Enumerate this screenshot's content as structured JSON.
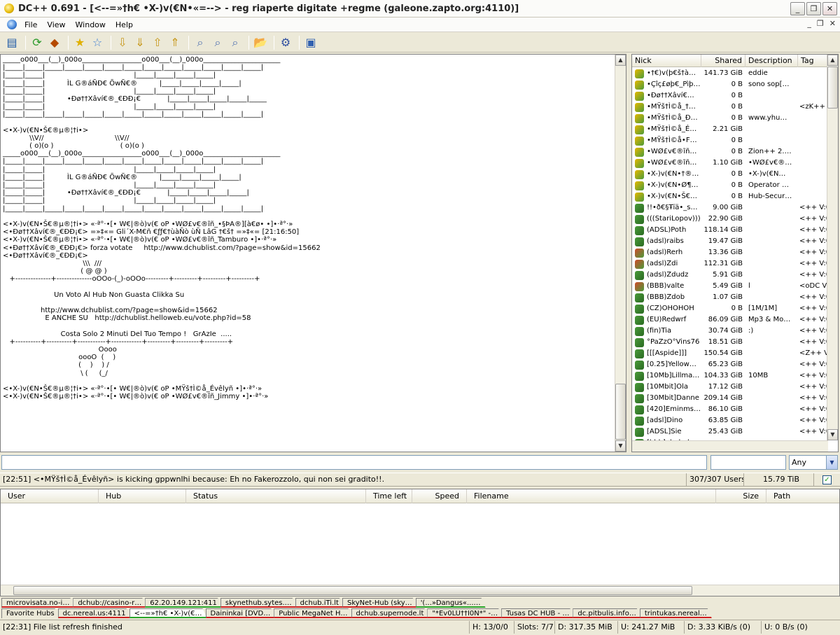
{
  "window": {
    "title": "DC++ 0.691 - [<--=»†h€ •X-)v(€N•«=--> -  reg riaperte digitate +regme (galeone.zapto.org:4110)]",
    "min_symbol": "_",
    "restore_symbol": "❐",
    "close_symbol": "✕"
  },
  "menu": {
    "items": [
      "File",
      "View",
      "Window",
      "Help"
    ],
    "mdi_min": "_",
    "mdi_restore": "❐",
    "mdi_close": "✕"
  },
  "toolbar": {
    "icons": [
      "public-hubs-icon",
      "reconnect-icon",
      "follow-redirect-icon",
      "favorite-hubs-icon",
      "favorite-users-icon",
      "download-queue-icon",
      "finished-downloads-icon",
      "upload-queue-icon",
      "finished-uploads-icon",
      "search-icon",
      "adl-search-icon",
      "search-spy-icon",
      "open-file-list-icon",
      "settings-icon",
      "notepad-icon"
    ],
    "glyphs": [
      "▤",
      "⟳",
      "◆",
      "★",
      "☆",
      "⇩",
      "⇓",
      "⇧",
      "⇑",
      "⌕",
      "⌕",
      "⌕",
      "📂",
      "⚙",
      "▣"
    ]
  },
  "chat": {
    "lines": [
      "_____o000___(__)_000o_________________o000___(__)_000o______________________",
      "|_____|_____|_____|_____|_____|_____|_____|_____|_____|_____|_____|_____|_____|",
      "|_____|_____|                                        |_____|_____|_____|_____|",
      "|_____|_____|          ÌL G®áÑÐ€ ÕwÑ€®          |_____|_____|_____|_____|",
      "|_____|_____|                                        |_____|_____|_____|_____|",
      "|_____|_____|          •Ðø††Xâví€®_€ÐÐ¡€            |_____|_____|_____|_____|_____",
      "|_____|_____|                                        |_____|_____|_____|_____|",
      "|_____|_____|_____|_____|_____|_____|_____|_____|_____|_____|_____|_____|_____|",
      "",
      "<•X-)v(€N•Š€®µ®¦†i•>",
      "            \\\\V//                                \\\\V//",
      "            ( o)(o )                              ( o)(o )",
      "_____o000___(__)_000o_________________o000___(__)_000o______________________",
      "|_____|_____|_____|_____|_____|_____|_____|_____|_____|_____|_____|_____|_____|",
      "|_____|_____|                                        |_____|_____|_____|_____|",
      "|_____|_____|          ÌL G®áÑÐ€ ÕwÑ€®          |_____|_____|_____|_____|",
      "|_____|_____|                                        |_____|_____|_____|_____|",
      "|_____|_____|          •Ðø††Xâví€®_€ÐÐ¡€            |_____|_____|_____|_____|",
      "|_____|_____|                                        |_____|_____|_____|_____|",
      "|_____|_____|_____|_____|_____|_____|_____|_____|_____|_____|_____|_____|_____|",
      "",
      "<•X-)v(€N•Š€®µ®¦†i•> «·ª°·•[• W€|®ò)v(€ oP •WØ£v€®ĩñ_•§ÞA®][à€ø• •]•·ª°·»",
      "<•Ðø††Xâví€®_€ÐÐ¡€> =»‡«= Gli´X-M€ñ €ƒƒ€†ùàÑò ùÑ LâG †€š† =»‡«= [21:16:50]",
      "<•X-)v(€N•Š€®µ®¦†i•> «·ª°·•[• W€|®ò)v(€ oP •WØ£v€®ĩñ_Tamburo •]•·ª°·»",
      "<•Ðø††Xâví€®_€ÐÐ¡€> forza votate     http://www.dchublist.com/?page=show&id=15662",
      "<•Ðø††Xâví€®_€ÐÐ¡€>",
      "                                    \\\\\\  ///",
      "                                   ( @ @ )",
      "   +--------------+--------------oOOo-(_)-oOOo---------+---------+---------+---------+",
      "",
      "                       Un Voto Al Hub Non Guasta Clikka Su",
      "",
      "                 http://www.dchublist.com/?page=show&id=15662",
      "                   E ANCHE SU   http://dchublist.helloweb.eu/vote.php?id=58",
      "",
      "                          Costa Solo 2 Minuti Del Tuo Tempo !   GrAzIe  .....",
      "   +----------+----------+-----------+------------+---------+---------+---------+",
      "                                           Oooo",
      "                                  oooO  (    )",
      "                                  (    )    ) /",
      "                                   \\ (     (_/",
      "",
      "<•X-)v(€N•Š€®µ®¦†i•> «·ª°·•[• W€|®ò)v(€ oP •MŸš†Ì©å_Évêlyñ •]•·ª°·»",
      "<•X-)v(€N•Š€®µ®¦†i•> «·ª°·•[• W€|®ò)v(€ oP •WØ£v€®ĩñ_Jimmy •]•·ª°·»"
    ]
  },
  "userlist": {
    "headers": [
      "Nick",
      "Shared",
      "Description",
      "Tag"
    ],
    "rows": [
      {
        "nick": "•†€)v(þ€š†à…",
        "shared": "141.73 GiB",
        "desc": "eddie",
        "tag": "",
        "kind": "op"
      },
      {
        "nick": "•Çîç£øþ€_Pìþ…",
        "shared": "0 B",
        "desc": "sono sop[…",
        "tag": "",
        "kind": "op"
      },
      {
        "nick": "•Ðø††Xâví€…",
        "shared": "0 B",
        "desc": "",
        "tag": "",
        "kind": "op"
      },
      {
        "nick": "•MŸš†Ì©å_†…",
        "shared": "0 B",
        "desc": "",
        "tag": "<zK++ V",
        "kind": "op"
      },
      {
        "nick": "•MŸš†Ì©å_Ð…",
        "shared": "0 B",
        "desc": "www.yhu…",
        "tag": "",
        "kind": "op"
      },
      {
        "nick": "•MŸš†Ì©å_É…",
        "shared": "2.21 GiB",
        "desc": "",
        "tag": "",
        "kind": "op"
      },
      {
        "nick": "•MŸš†Ì©å•F…",
        "shared": "0 B",
        "desc": "",
        "tag": "",
        "kind": "op"
      },
      {
        "nick": "•WØ£v€®ĩñ…",
        "shared": "0 B",
        "desc": "Zion++ 2.…",
        "tag": "",
        "kind": "op"
      },
      {
        "nick": "•WØ£v€®ĩñ…",
        "shared": "1.10 GiB",
        "desc": "•WØ£v€®…",
        "tag": "",
        "kind": "op"
      },
      {
        "nick": "•X-)v(€N•†®…",
        "shared": "0 B",
        "desc": "•X-)v(€N…",
        "tag": "",
        "kind": "op"
      },
      {
        "nick": "•X-)v(€N•Ø¶…",
        "shared": "0 B",
        "desc": "Operator …",
        "tag": "",
        "kind": "op"
      },
      {
        "nick": "•X-)v(€N•Š€…",
        "shared": "0 B",
        "desc": "Hub-Secur…",
        "tag": "",
        "kind": "op"
      },
      {
        "nick": "!!•ð€§Ŧïä•_s…",
        "shared": "9.00 GiB",
        "desc": "",
        "tag": "<++ V:0",
        "kind": "user"
      },
      {
        "nick": "(((StariLopov)))",
        "shared": "22.90 GiB",
        "desc": "",
        "tag": "<++ V:0",
        "kind": "user"
      },
      {
        "nick": "(ADSL)Poth",
        "shared": "118.14 GiB",
        "desc": "",
        "tag": "<++ V:0",
        "kind": "user"
      },
      {
        "nick": "(adsl)raibs",
        "shared": "19.47 GiB",
        "desc": "",
        "tag": "<++ V:0",
        "kind": "user"
      },
      {
        "nick": "(adsl)Rerh",
        "shared": "13.36 GiB",
        "desc": "",
        "tag": "<++ V:0",
        "kind": "red"
      },
      {
        "nick": "(adsl)Zdi",
        "shared": "112.31 GiB",
        "desc": "",
        "tag": "<++ V:0",
        "kind": "red"
      },
      {
        "nick": "(adsl)Zdudz",
        "shared": "5.91 GiB",
        "desc": "",
        "tag": "<++ V:0",
        "kind": "user"
      },
      {
        "nick": "(BBB)valte",
        "shared": "5.49 GiB",
        "desc": "l",
        "tag": "<oDC V:",
        "kind": "red"
      },
      {
        "nick": "(BBB)Zdob",
        "shared": "1.07 GiB",
        "desc": "",
        "tag": "<++ V:0",
        "kind": "user"
      },
      {
        "nick": "(CZ)OHOHOH",
        "shared": "0 B",
        "desc": "[1M/1M]",
        "tag": "<++ V:0",
        "kind": "user"
      },
      {
        "nick": "(EU)Redwrf",
        "shared": "86.09 GiB",
        "desc": "Mp3 & Mo…",
        "tag": "<++ V:0",
        "kind": "user"
      },
      {
        "nick": "(fin)Tia",
        "shared": "30.74 GiB",
        "desc": ":)",
        "tag": "<++ V:0",
        "kind": "user"
      },
      {
        "nick": "°PaZzO°Vins76",
        "shared": "18.51 GiB",
        "desc": "",
        "tag": "<++ V:0",
        "kind": "user"
      },
      {
        "nick": "[[[Aspide]]]",
        "shared": "150.54 GiB",
        "desc": "",
        "tag": "<Z++ V:",
        "kind": "user"
      },
      {
        "nick": "[0.25]Yellow…",
        "shared": "65.23 GiB",
        "desc": "",
        "tag": "<++ V:0",
        "kind": "user"
      },
      {
        "nick": "[10Mb]Lillma…",
        "shared": "104.33 GiB",
        "desc": "10MB",
        "tag": "<++ V:0",
        "kind": "user"
      },
      {
        "nick": "[10Mbit]Ola",
        "shared": "17.12 GiB",
        "desc": "",
        "tag": "<++ V:0",
        "kind": "user"
      },
      {
        "nick": "[30Mbit]Danne",
        "shared": "209.14 GiB",
        "desc": "",
        "tag": "<++ V:0",
        "kind": "user"
      },
      {
        "nick": "[420]Eminms…",
        "shared": "86.10 GiB",
        "desc": "",
        "tag": "<++ V:0",
        "kind": "user"
      },
      {
        "nick": "[adsl]Dino",
        "shared": "63.85 GiB",
        "desc": "",
        "tag": "<++ V:0",
        "kind": "user"
      },
      {
        "nick": "[ADSL]Sie",
        "shared": "25.43 GiB",
        "desc": "",
        "tag": "<++ V:0",
        "kind": "user"
      },
      {
        "nick": "[bbb]ebebebe",
        "shared": "",
        "desc": "",
        "tag": "",
        "kind": "user"
      }
    ]
  },
  "input": {
    "message": "",
    "search": "",
    "filter": "Any"
  },
  "hubstatus": {
    "message": "[22:51] <•MŸš†Ì©å_Évêlyñ> is kicking gppwnlhi because:  Eh no Fakerozzolo, qui non sei gradito!!.",
    "users": "307/307 Users",
    "share": "15.79 TiB",
    "checkbox": "✓"
  },
  "transfers": {
    "headers": [
      "User",
      "Hub",
      "Status",
      "Time left",
      "Speed",
      "Filename",
      "Size",
      "Path"
    ]
  },
  "tabs": {
    "row1": [
      {
        "label": "microvisata.no-i…",
        "mark": "red"
      },
      {
        "label": "dchub://casino-r…",
        "mark": "red"
      },
      {
        "label": "62.20.149.121:411",
        "mark": "green"
      },
      {
        "label": "skynethub.sytes.…",
        "mark": "red"
      },
      {
        "label": "dchub.iTi.lt",
        "mark": "red"
      },
      {
        "label": "SkyNet-Hub  (sky…",
        "mark": "red"
      },
      {
        "label": "'(...»Dangus«...…",
        "mark": "green"
      }
    ],
    "row2": [
      {
        "label": "Favorite Hubs",
        "mark": "none"
      },
      {
        "label": "dc.nereal.us:4111",
        "mark": "red"
      },
      {
        "label": "<--=»†h€ •X-)v(€…",
        "mark": "active"
      },
      {
        "label": "Daininkai [DVD…",
        "mark": "red"
      },
      {
        "label": "Public MegaNet H…",
        "mark": "red"
      },
      {
        "label": "dchub.supernode.lt",
        "mark": "red"
      },
      {
        "label": "\"*Ev0LU††I0N*\" -…",
        "mark": "red"
      },
      {
        "label": "Tusas DC HUB - …",
        "mark": "red"
      },
      {
        "label": "dc.pitbulis.info…",
        "mark": "red"
      },
      {
        "label": "trintukas.nereal…",
        "mark": "red"
      }
    ]
  },
  "status": {
    "message": "[22:31] File list refresh finished",
    "hubs": "H: 13/0/0",
    "slots": "Slots: 7/7",
    "downloaded": "D: 317.35 MiB",
    "uploaded": "U: 241.27 MiB",
    "down_speed": "D: 3.33 KiB/s (0)",
    "up_speed": "U: 0 B/s (0)"
  }
}
